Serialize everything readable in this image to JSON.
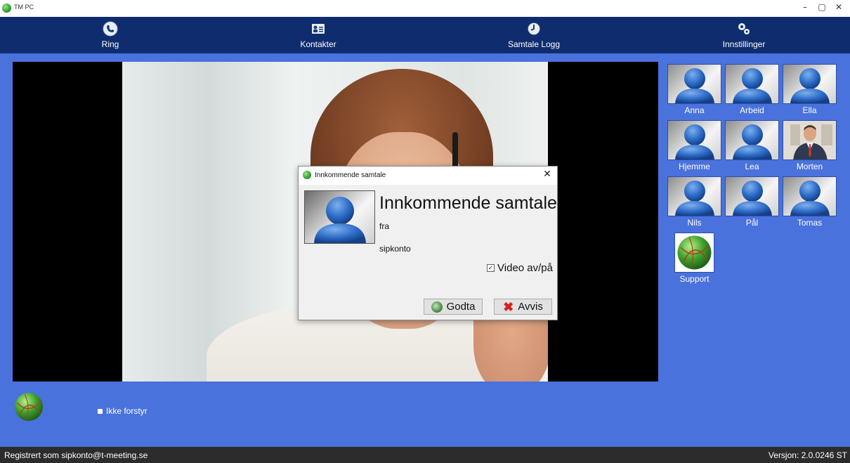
{
  "window": {
    "title": "TM PC",
    "controls": [
      "–",
      "▢",
      "✕"
    ]
  },
  "nav": {
    "items": [
      {
        "label": "Ring",
        "icon": "phone-globe-icon"
      },
      {
        "label": "Kontakter",
        "icon": "contacts-card-icon"
      },
      {
        "label": "Samtale Logg",
        "icon": "clock-icon"
      },
      {
        "label": "Innstillinger",
        "icon": "gears-icon"
      }
    ]
  },
  "dialog": {
    "title": "Innkommende samtale",
    "heading": "Innkommende samtale",
    "from_label": "fra",
    "caller": "sipkonto",
    "video_toggle_label": "Video av/på",
    "video_checked": true,
    "accept_label": "Godta",
    "reject_label": "Avvis"
  },
  "contacts": [
    {
      "name": "Anna"
    },
    {
      "name": "Arbeid"
    },
    {
      "name": "Ella"
    },
    {
      "name": "Hjemme"
    },
    {
      "name": "Lea"
    },
    {
      "name": "Morten"
    },
    {
      "name": "Nils"
    },
    {
      "name": "Pål"
    },
    {
      "name": "Tomas"
    },
    {
      "name": "Support"
    }
  ],
  "do_not_disturb": {
    "label": "Ikke forstyr"
  },
  "status": {
    "registered": "Registrert som sipkonto@t-meeting.se",
    "version": "Versjon: 2.0.0246 ST"
  },
  "colors": {
    "background": "#4a72dc",
    "nav": "#0f2d6e",
    "statusbar": "#2c2c2c"
  }
}
